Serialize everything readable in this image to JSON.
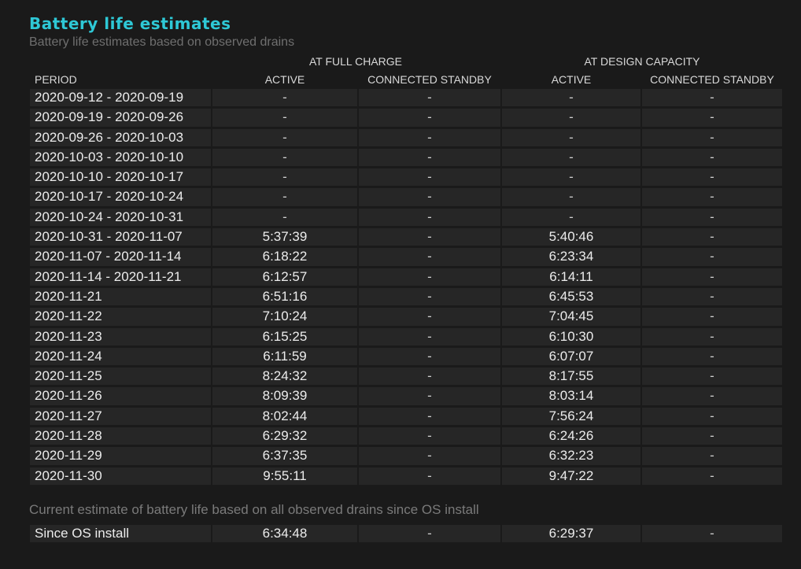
{
  "report": {
    "title": "Battery life estimates",
    "subtitle": "Battery life estimates based on observed drains",
    "group_full_charge": "AT FULL CHARGE",
    "group_design_capacity": "AT DESIGN CAPACITY",
    "columns": {
      "period": "PERIOD",
      "full_active": "ACTIVE",
      "full_standby": "CONNECTED STANDBY",
      "design_active": "ACTIVE",
      "design_standby": "CONNECTED STANDBY"
    },
    "rows": [
      {
        "period": "2020-09-12 - 2020-09-19",
        "full_active": "-",
        "full_standby": "-",
        "design_active": "-",
        "design_standby": "-"
      },
      {
        "period": "2020-09-19 - 2020-09-26",
        "full_active": "-",
        "full_standby": "-",
        "design_active": "-",
        "design_standby": "-"
      },
      {
        "period": "2020-09-26 - 2020-10-03",
        "full_active": "-",
        "full_standby": "-",
        "design_active": "-",
        "design_standby": "-"
      },
      {
        "period": "2020-10-03 - 2020-10-10",
        "full_active": "-",
        "full_standby": "-",
        "design_active": "-",
        "design_standby": "-"
      },
      {
        "period": "2020-10-10 - 2020-10-17",
        "full_active": "-",
        "full_standby": "-",
        "design_active": "-",
        "design_standby": "-"
      },
      {
        "period": "2020-10-17 - 2020-10-24",
        "full_active": "-",
        "full_standby": "-",
        "design_active": "-",
        "design_standby": "-"
      },
      {
        "period": "2020-10-24 - 2020-10-31",
        "full_active": "-",
        "full_standby": "-",
        "design_active": "-",
        "design_standby": "-"
      },
      {
        "period": "2020-10-31 - 2020-11-07",
        "full_active": "5:37:39",
        "full_standby": "-",
        "design_active": "5:40:46",
        "design_standby": "-"
      },
      {
        "period": "2020-11-07 - 2020-11-14",
        "full_active": "6:18:22",
        "full_standby": "-",
        "design_active": "6:23:34",
        "design_standby": "-"
      },
      {
        "period": "2020-11-14 - 2020-11-21",
        "full_active": "6:12:57",
        "full_standby": "-",
        "design_active": "6:14:11",
        "design_standby": "-"
      },
      {
        "period": "2020-11-21",
        "full_active": "6:51:16",
        "full_standby": "-",
        "design_active": "6:45:53",
        "design_standby": "-"
      },
      {
        "period": "2020-11-22",
        "full_active": "7:10:24",
        "full_standby": "-",
        "design_active": "7:04:45",
        "design_standby": "-"
      },
      {
        "period": "2020-11-23",
        "full_active": "6:15:25",
        "full_standby": "-",
        "design_active": "6:10:30",
        "design_standby": "-"
      },
      {
        "period": "2020-11-24",
        "full_active": "6:11:59",
        "full_standby": "-",
        "design_active": "6:07:07",
        "design_standby": "-"
      },
      {
        "period": "2020-11-25",
        "full_active": "8:24:32",
        "full_standby": "-",
        "design_active": "8:17:55",
        "design_standby": "-"
      },
      {
        "period": "2020-11-26",
        "full_active": "8:09:39",
        "full_standby": "-",
        "design_active": "8:03:14",
        "design_standby": "-"
      },
      {
        "period": "2020-11-27",
        "full_active": "8:02:44",
        "full_standby": "-",
        "design_active": "7:56:24",
        "design_standby": "-"
      },
      {
        "period": "2020-11-28",
        "full_active": "6:29:32",
        "full_standby": "-",
        "design_active": "6:24:26",
        "design_standby": "-"
      },
      {
        "period": "2020-11-29",
        "full_active": "6:37:35",
        "full_standby": "-",
        "design_active": "6:32:23",
        "design_standby": "-"
      },
      {
        "period": "2020-11-30",
        "full_active": "9:55:11",
        "full_standby": "-",
        "design_active": "9:47:22",
        "design_standby": "-"
      }
    ],
    "current_estimate_note": "Current estimate of battery life based on all observed drains since OS install",
    "since_install": {
      "period": "Since OS install",
      "full_active": "6:34:48",
      "full_standby": "-",
      "design_active": "6:29:37",
      "design_standby": "-"
    }
  },
  "colors": {
    "background": "#1a1a1a",
    "title": "#2ec8d6",
    "cell_background": "#262626",
    "text": "#ececec",
    "muted_text": "#6f6f6f"
  }
}
